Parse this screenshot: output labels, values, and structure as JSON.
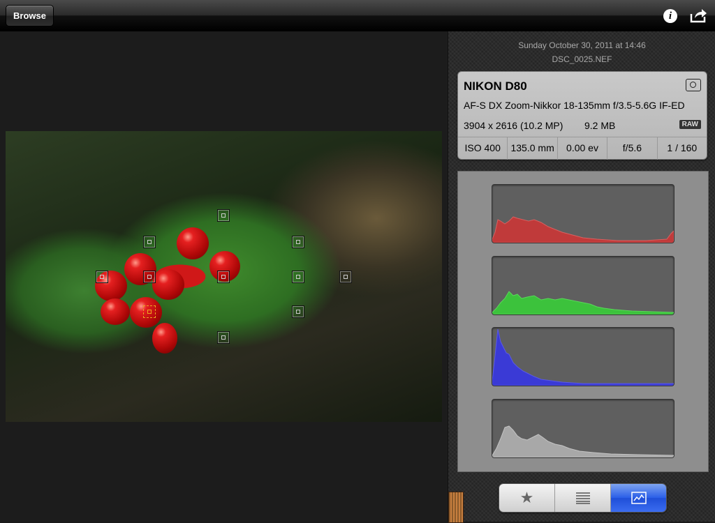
{
  "toolbar": {
    "browse_label": "Browse",
    "info_glyph": "i",
    "info_icon": "info-icon",
    "share_icon": "share-icon"
  },
  "photo": {
    "description_icon": "photo-image",
    "active_af_point": 8
  },
  "info": {
    "datetime": "Sunday October 30, 2011 at 14:46",
    "filename": "DSC_0025.NEF",
    "camera": "NIKON D80",
    "lens": "AF-S DX Zoom-Nikkor 18-135mm f/3.5-5.6G IF-ED",
    "resolution": "3904 x 2616 (10.2 MP)",
    "filesize": "9.2 MB",
    "format_badge": "RAW",
    "iso": "ISO 400",
    "focal_length": "135.0 mm",
    "exposure_comp": "0.00 ev",
    "aperture": "f/5.6",
    "shutter": "1 / 160"
  },
  "histograms": [
    {
      "channel": "red",
      "color": "#c03a3a"
    },
    {
      "channel": "green",
      "color": "#3cc23c"
    },
    {
      "channel": "blue",
      "color": "#3a3ad6"
    },
    {
      "channel": "luminance",
      "color": "#a8a8a8"
    }
  ],
  "tabs": {
    "favorite_icon": "star-icon",
    "list_icon": "list-icon",
    "histogram_icon": "chart-icon",
    "selected": "histogram"
  },
  "colors": {
    "accent": "#2a5ee8",
    "af_active": "#e8a820"
  }
}
